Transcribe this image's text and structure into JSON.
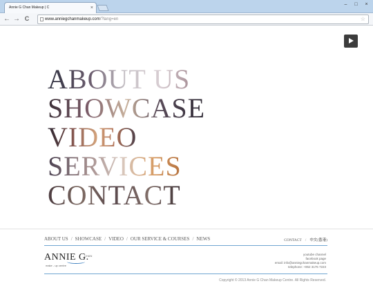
{
  "browser": {
    "tab_title": "Annie G Chan Makeup | C",
    "tab_close": "×",
    "window_buttons": [
      "–",
      "□",
      "×"
    ],
    "back": "←",
    "forward": "→",
    "reload": "C",
    "url_main": "www.anniegchanmakeup.com",
    "url_rest": "/?lang=en",
    "star": "☆"
  },
  "menu": [
    "ABOUT US",
    "SHOWCASE",
    "VIDEO",
    "SERVICES",
    "CONTACT"
  ],
  "footer_nav": {
    "items": [
      "ABOUT US",
      "SHOWCASE",
      "VIDEO",
      "OUR SERVICE & COURSES",
      "NEWS"
    ],
    "separator": "/"
  },
  "footer_right": {
    "contact": "CONTACT",
    "separator": "/",
    "chinese": "中文(香港)"
  },
  "logo": {
    "main": "ANNIE G.",
    "sup": "CHAN",
    "sub": "make - up centre"
  },
  "contact_lines": [
    "youtube channel",
    "facebook page",
    "email: info@anniegchanmakeup.com",
    "telephone: +852 3176 7223"
  ],
  "copyright": "Copyright © 2013 Annie G Chan Makeup Centre. All Rights Reserved."
}
